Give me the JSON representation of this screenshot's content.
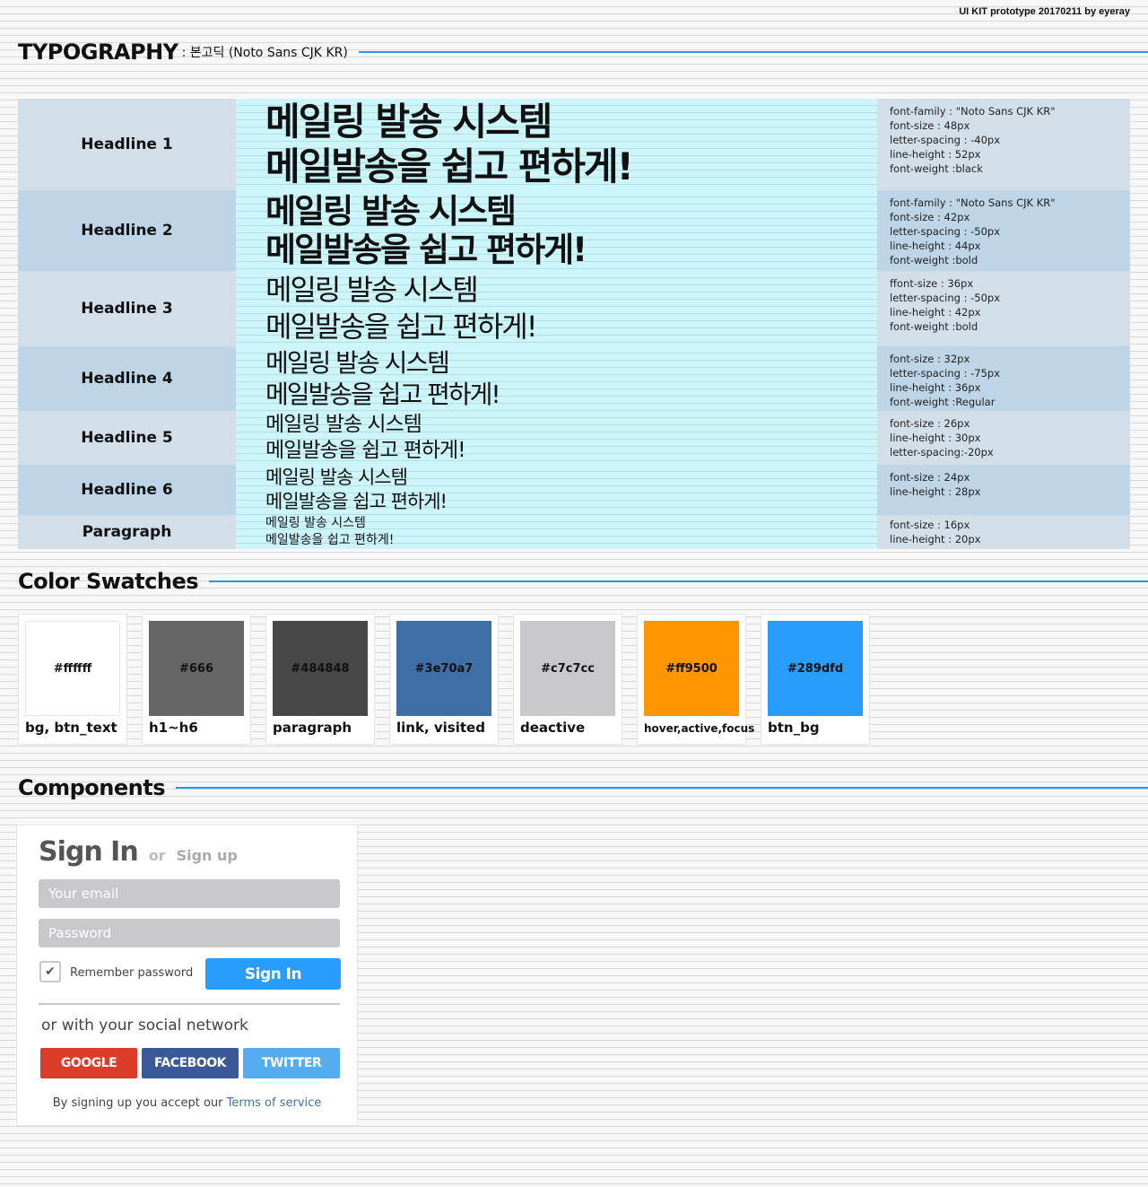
{
  "credit": "UI KIT prototype 20170211 by eyeray",
  "sections": {
    "typography": {
      "title": "TYPOGRAPHY",
      "subtitle": ": 본고딕 (Noto Sans CJK KR)"
    },
    "colors": {
      "title": "Color Swatches"
    },
    "components": {
      "title": "Components"
    }
  },
  "sample": {
    "line1": "메일링 발송 시스템",
    "line2": "메일발송을 쉽고 편하게!"
  },
  "typography_rows": [
    {
      "label": "Headline 1",
      "specs": [
        "font-family : \"Noto Sans CJK KR\"",
        "font-size : 48px",
        "letter-spacing : -40px",
        "line-height : 52px",
        "font-weight :black"
      ]
    },
    {
      "label": "Headline 2",
      "specs": [
        "font-family : \"Noto Sans CJK KR\"",
        "font-size : 42px",
        "letter-spacing : -50px",
        "line-height : 44px",
        "font-weight :bold"
      ]
    },
    {
      "label": "Headline 3",
      "specs": [
        "ffont-size : 36px",
        "letter-spacing : -50px",
        "line-height : 42px",
        "font-weight :bold"
      ]
    },
    {
      "label": "Headline 4",
      "specs": [
        "font-size : 32px",
        "letter-spacing : -75px",
        "line-height : 36px",
        "font-weight :Regular"
      ]
    },
    {
      "label": "Headline 5",
      "specs": [
        "font-size : 26px",
        "line-height : 30px",
        "letter-spacing:-20px"
      ]
    },
    {
      "label": "Headline 6",
      "specs": [
        "font-size : 24px",
        "line-height : 28px"
      ]
    },
    {
      "label": "Paragraph",
      "specs": [
        "font-size : 16px",
        "line-height : 20px"
      ]
    }
  ],
  "swatches": [
    {
      "hex": "#ffffff",
      "name": "bg, btn_text"
    },
    {
      "hex": "#666",
      "name": "h1~h6"
    },
    {
      "hex": "#484848",
      "name": "paragraph"
    },
    {
      "hex": "#3e70a7",
      "name": "link, visited"
    },
    {
      "hex": "#c7c7cc",
      "name": "deactive"
    },
    {
      "hex": "#ff9500",
      "name": "hover,active,focus"
    },
    {
      "hex": "#289dfd",
      "name": "btn_bg"
    }
  ],
  "signin": {
    "title": "Sign In",
    "or": "or",
    "signup": "Sign up",
    "email_placeholder": "Your email",
    "password_placeholder": "Password",
    "remember": "Remember password",
    "check": "✔",
    "button": "Sign In",
    "social_title": "or with your social network",
    "google": "GOOGLE",
    "facebook": "FACEBOOK",
    "twitter": "TWITTER",
    "terms_prefix": "By signing up you accept our",
    "terms_link": "Terms of service"
  },
  "colors": {
    "accent": "#289dfd",
    "google": "#dc3c2a",
    "facebook": "#3b5998",
    "twitter": "#55acee",
    "link": "#3e70a7"
  }
}
